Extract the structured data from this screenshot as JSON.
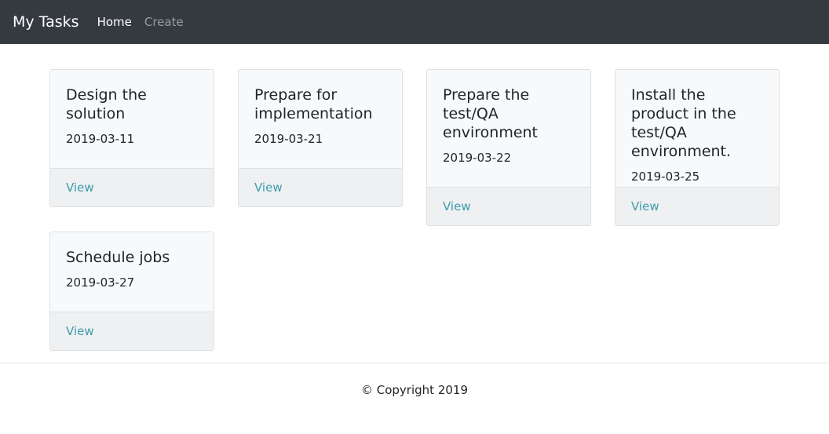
{
  "navbar": {
    "brand": "My Tasks",
    "links": [
      {
        "label": "Home",
        "active": true
      },
      {
        "label": "Create",
        "active": false
      }
    ]
  },
  "tasks": [
    {
      "title": "Design the solution",
      "date": "2019-03-11",
      "link": "View"
    },
    {
      "title": "Prepare for implementation",
      "date": "2019-03-21",
      "link": "View"
    },
    {
      "title": "Prepare the test/QA environment",
      "date": "2019-03-22",
      "link": "View"
    },
    {
      "title": "Install the product in the test/QA environment.",
      "date": "2019-03-25",
      "link": "View"
    },
    {
      "title": "Schedule jobs",
      "date": "2019-03-27",
      "link": "View"
    }
  ],
  "footer": {
    "copyright": "© Copyright 2019"
  },
  "colors": {
    "navbar_bg": "#343a40",
    "link": "#3a9cae",
    "card_bg": "#f8f9fa",
    "card_footer_bg": "#eff0f1"
  }
}
